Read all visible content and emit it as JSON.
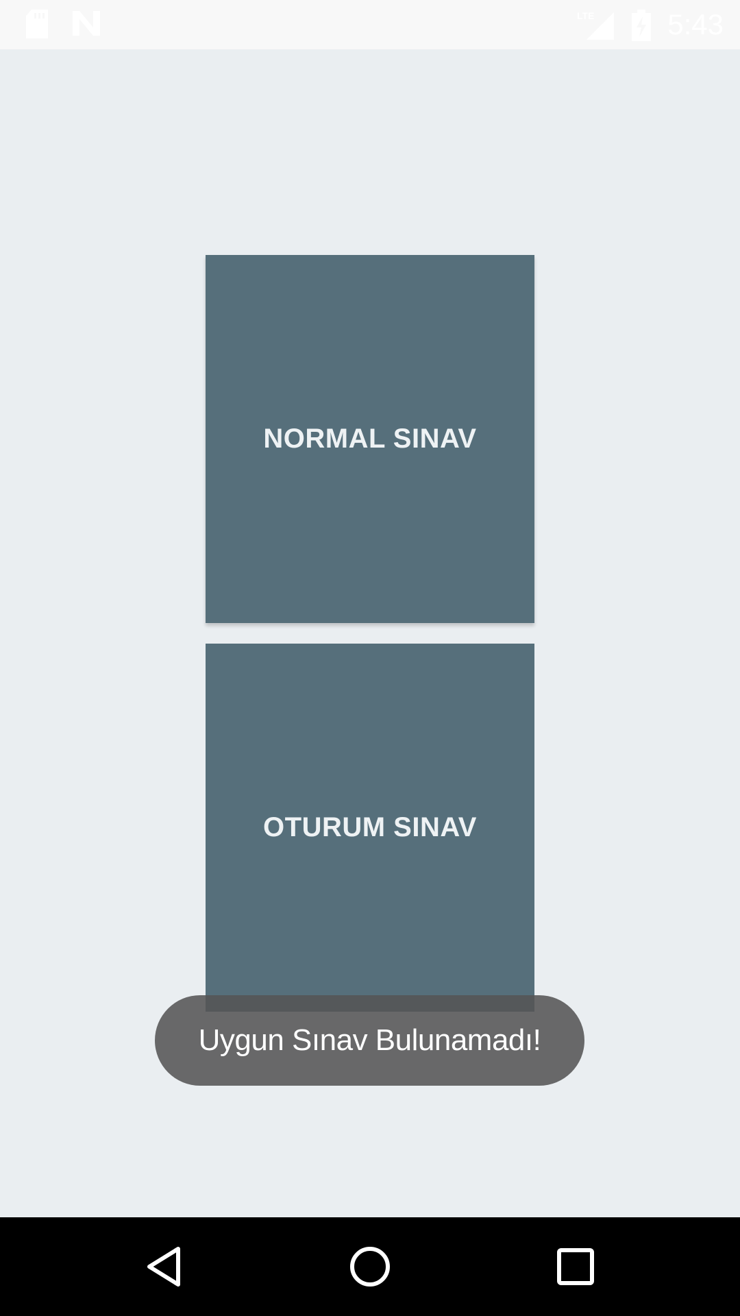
{
  "status_bar": {
    "time": "5:43",
    "icons": [
      "sd-card-icon",
      "n-notification-icon",
      "lte-signal-icon",
      "battery-charging-icon"
    ]
  },
  "main": {
    "normal_button_label": "NORMAL SINAV",
    "oturum_button_label": "OTURUM SINAV"
  },
  "toast": {
    "message": "Uygun Sınav Bulunamadı!"
  },
  "nav_bar": {
    "icons": [
      "back-icon",
      "home-icon",
      "recents-icon"
    ]
  },
  "colors": {
    "background": "#EAEEF1",
    "tile": "#566F7B",
    "toast": "#555555",
    "nav_bar": "#000000"
  }
}
